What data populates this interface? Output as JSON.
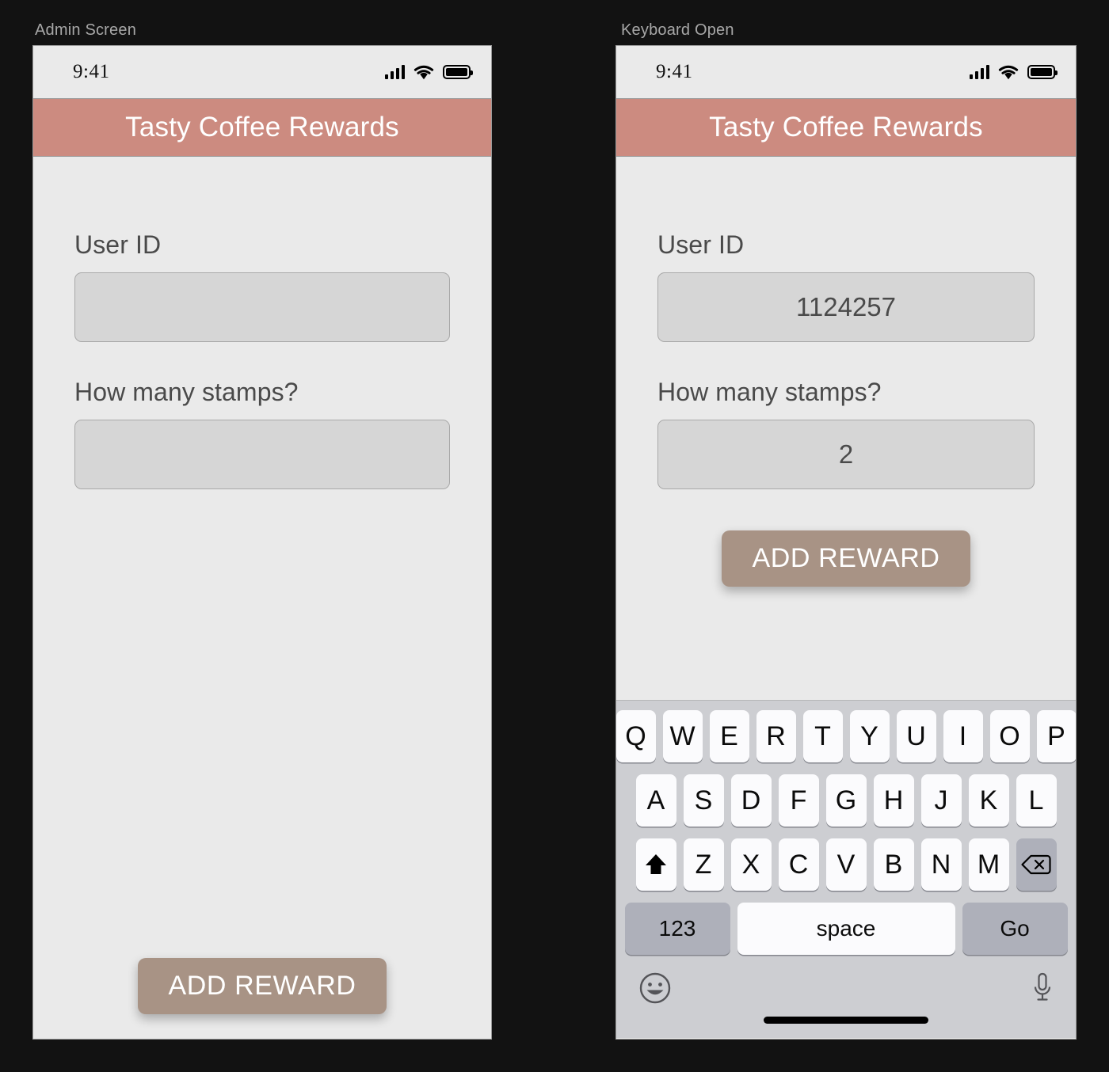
{
  "frames": [
    {
      "caption": "Admin Screen"
    },
    {
      "caption": "Keyboard Open"
    }
  ],
  "status_bar": {
    "time": "9:41",
    "icons": [
      "cellular-signal-icon",
      "wifi-icon",
      "battery-icon"
    ]
  },
  "app": {
    "title": "Tasty Coffee Rewards",
    "accent_header": "#cc8b80",
    "accent_button": "#a89385",
    "screen_background": "#eaeaea",
    "field_background": "#d6d6d6"
  },
  "screen_left": {
    "fields": [
      {
        "label": "User ID",
        "value": "",
        "placeholder": ""
      },
      {
        "label": "How many stamps?",
        "value": "",
        "placeholder": ""
      }
    ],
    "submit_label": "ADD REWARD"
  },
  "screen_right": {
    "fields": [
      {
        "label": "User ID",
        "value": "1124257",
        "placeholder": ""
      },
      {
        "label": "How many stamps?",
        "value": "2",
        "placeholder": ""
      }
    ],
    "submit_label": "ADD REWARD"
  },
  "keyboard": {
    "background": "#cdced2",
    "row1": [
      "Q",
      "W",
      "E",
      "R",
      "T",
      "Y",
      "U",
      "I",
      "O",
      "P"
    ],
    "row2": [
      "A",
      "S",
      "D",
      "F",
      "G",
      "H",
      "J",
      "K",
      "L"
    ],
    "row3": [
      "Z",
      "X",
      "C",
      "V",
      "B",
      "N",
      "M"
    ],
    "shift_key": "shift-icon",
    "backspace_key": "backspace-icon",
    "numbers_key": "123",
    "space_key": "space",
    "return_key": "Go",
    "emoji_key": "emoji-icon",
    "dictation_key": "microphone-icon"
  }
}
